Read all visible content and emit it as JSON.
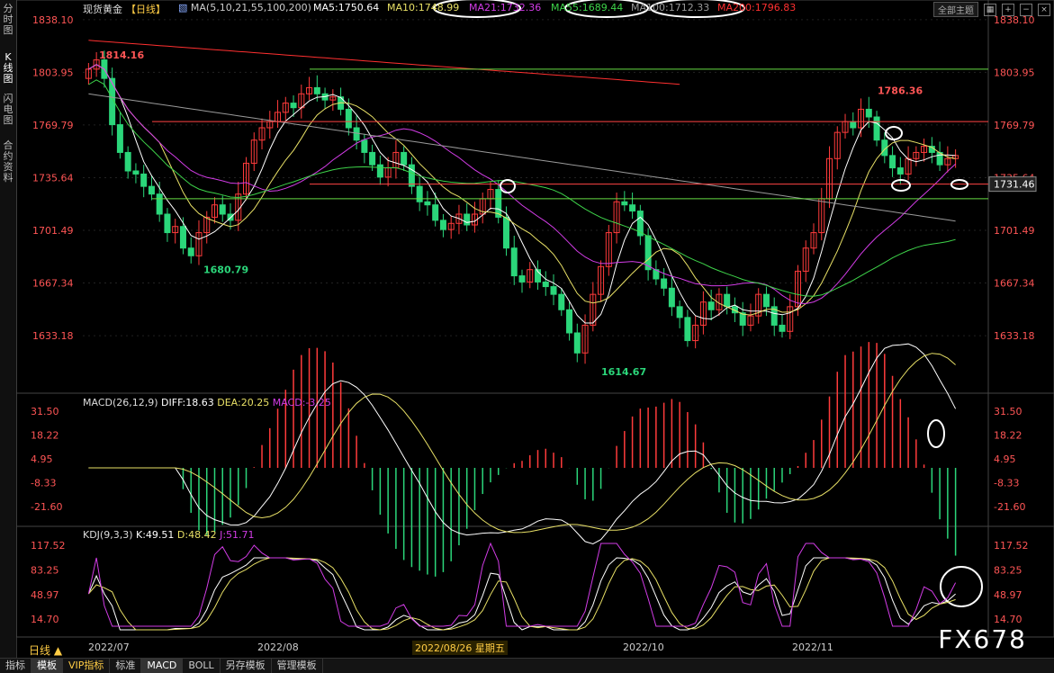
{
  "left_tabs": [
    "分时图",
    "K线图",
    "闪电图",
    "合约资料"
  ],
  "header": {
    "symbol": "现货黄金",
    "period": "【日线】",
    "ma_params": "MA(5,10,21,55,100,200)",
    "ma5": "MA5:1750.64",
    "ma10": "MA10:1748.99",
    "ma21": "MA21:1732.36",
    "ma55": "MA55:1689.44",
    "ma100": "MA100:1712.33",
    "ma200": "MA200:1796.83",
    "theme_btn": "全部主题"
  },
  "colors": {
    "up": "#ff3b3b",
    "down": "#2bd67a",
    "ma5": "#ffffff",
    "ma10": "#e8e066",
    "ma21": "#d23ce6",
    "ma55": "#3ed44a",
    "ma100": "#9a9a9a",
    "ma200": "#ff3030"
  },
  "price_axis": [
    "1838.10",
    "1803.95",
    "1769.79",
    "1735.64",
    "1701.49",
    "1667.34",
    "1633.18"
  ],
  "price_tag": "1731.46",
  "annotations": {
    "high1": "1814.16",
    "low1": "1680.79",
    "low2": "1614.67",
    "high2": "1786.36"
  },
  "macd": {
    "title": "MACD(26,12,9)",
    "diff": "DIFF:18.63",
    "dea": "DEA:20.25",
    "macd": "MACD:-3.25",
    "axis": [
      "31.50",
      "18.22",
      "4.95",
      "-8.33",
      "-21.60"
    ]
  },
  "kdj": {
    "title": "KDJ(9,3,3)",
    "k": "K:49.51",
    "d": "D:48.42",
    "j": "J:51.71",
    "axis": [
      "117.52",
      "83.25",
      "48.97",
      "14.70"
    ]
  },
  "date_axis": [
    "2022/07",
    "2022/08",
    "2022/10",
    "2022/11"
  ],
  "cursor_date": "2022/08/26 星期五",
  "period_button": "日线 ▲",
  "bottom_tabs": [
    "指标",
    "模板",
    "VIP指标",
    "标准",
    "MACD",
    "BOLL",
    "另存模板",
    "管理模板"
  ],
  "watermark": "FX678",
  "chart_data": {
    "type": "candlestick",
    "title": "现货黄金",
    "ylim": [
      1600,
      1845
    ],
    "x_dates": [
      "2022/07",
      "2022/08",
      "2022/10",
      "2022/11"
    ],
    "ohlc_anchors": [
      {
        "label": "high",
        "value": 1814.16
      },
      {
        "label": "low",
        "value": 1680.79
      },
      {
        "label": "low",
        "value": 1614.67
      },
      {
        "label": "high",
        "value": 1786.36
      }
    ],
    "series": [
      {
        "name": "MA5",
        "value": 1750.64
      },
      {
        "name": "MA10",
        "value": 1748.99
      },
      {
        "name": "MA21",
        "value": 1732.36
      },
      {
        "name": "MA55",
        "value": 1689.44
      },
      {
        "name": "MA100",
        "value": 1712.33
      },
      {
        "name": "MA200",
        "value": 1796.83
      }
    ],
    "close_path": [
      1806,
      1812,
      1800,
      1770,
      1752,
      1740,
      1738,
      1730,
      1725,
      1712,
      1700,
      1704,
      1690,
      1685,
      1700,
      1710,
      1718,
      1712,
      1708,
      1725,
      1745,
      1760,
      1768,
      1772,
      1778,
      1784,
      1781,
      1790,
      1794,
      1790,
      1786,
      1788,
      1780,
      1768,
      1760,
      1752,
      1744,
      1736,
      1742,
      1752,
      1744,
      1730,
      1720,
      1718,
      1708,
      1702,
      1706,
      1712,
      1705,
      1712,
      1722,
      1728,
      1710,
      1690,
      1672,
      1668,
      1676,
      1668,
      1665,
      1660,
      1650,
      1635,
      1622,
      1640,
      1660,
      1678,
      1700,
      1720,
      1718,
      1714,
      1698,
      1676,
      1670,
      1664,
      1652,
      1645,
      1630,
      1640,
      1655,
      1650,
      1660,
      1652,
      1648,
      1640,
      1646,
      1660,
      1652,
      1640,
      1636,
      1652,
      1675,
      1690,
      1700,
      1722,
      1748,
      1765,
      1772,
      1768,
      1780,
      1775,
      1760,
      1750,
      1742,
      1738,
      1748,
      1752,
      1756,
      1752,
      1744,
      1748,
      1750
    ],
    "macd_values": {
      "diff": 18.63,
      "dea": 20.25,
      "macd": -3.25
    },
    "kdj_values": {
      "k": 49.51,
      "d": 48.42,
      "j": 51.71
    }
  }
}
